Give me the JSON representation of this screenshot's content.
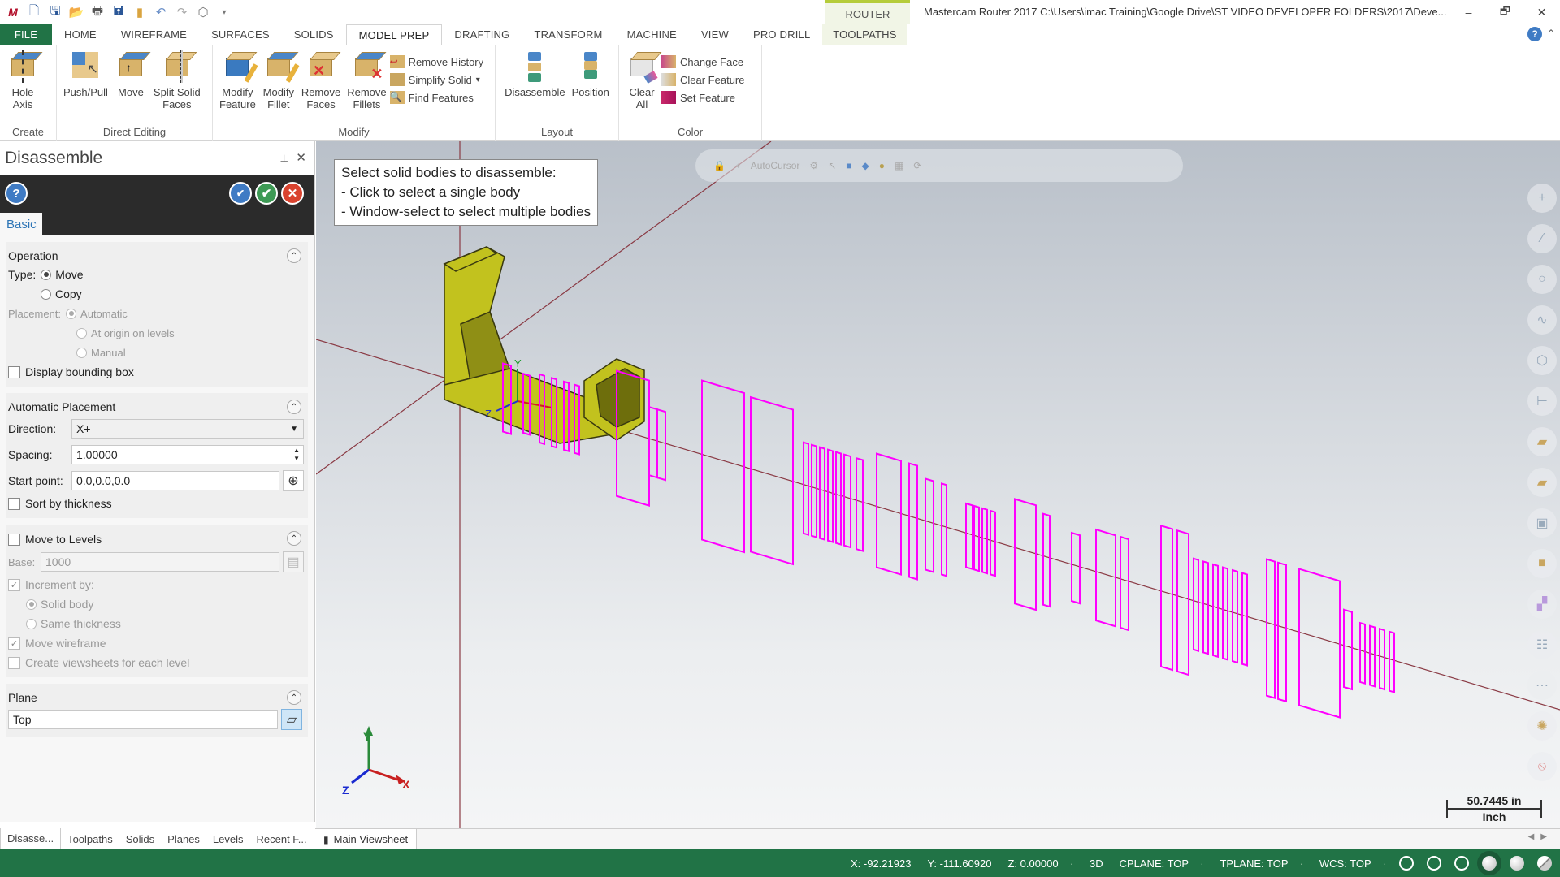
{
  "app": {
    "title": "Mastercam Router 2017  C:\\Users\\imac Training\\Google Drive\\ST VIDEO DEVELOPER FOLDERS\\2017\\Deve...",
    "context_tab": "ROUTER",
    "window_controls": {
      "minimize": "–",
      "restore": "🗗",
      "close": "✕"
    }
  },
  "quick_access": [
    "mastercam-logo",
    "new-icon",
    "save-icon",
    "open-icon",
    "print-icon",
    "save-as-icon",
    "folder-icon",
    "undo-icon",
    "redo-icon",
    "cube-icon",
    "customize-icon"
  ],
  "tabs": [
    {
      "label": "FILE",
      "kind": "file"
    },
    {
      "label": "HOME"
    },
    {
      "label": "WIREFRAME"
    },
    {
      "label": "SURFACES"
    },
    {
      "label": "SOLIDS"
    },
    {
      "label": "MODEL PREP",
      "active": true
    },
    {
      "label": "DRAFTING"
    },
    {
      "label": "TRANSFORM"
    },
    {
      "label": "MACHINE"
    },
    {
      "label": "VIEW"
    },
    {
      "label": "PRO DRILL"
    },
    {
      "label": "TOOLPATHS",
      "context": true
    }
  ],
  "ribbon": {
    "groups": [
      {
        "label": "Create",
        "buttons": [
          {
            "label1": "Hole",
            "label2": "Axis",
            "icon": "hole-axis-icon"
          }
        ]
      },
      {
        "label": "Direct Editing",
        "buttons": [
          {
            "label1": "Push/Pull",
            "label2": "",
            "icon": "push-pull-icon"
          },
          {
            "label1": "Move",
            "label2": "",
            "icon": "move-icon"
          },
          {
            "label1": "Split Solid",
            "label2": "Faces",
            "icon": "split-solid-faces-icon"
          }
        ]
      },
      {
        "label": "Modify",
        "buttons": [
          {
            "label1": "Modify",
            "label2": "Feature",
            "icon": "modify-feature-icon"
          },
          {
            "label1": "Modify",
            "label2": "Fillet",
            "icon": "modify-fillet-icon"
          },
          {
            "label1": "Remove",
            "label2": "Faces",
            "icon": "remove-faces-icon"
          },
          {
            "label1": "Remove",
            "label2": "Fillets",
            "icon": "remove-fillets-icon"
          }
        ],
        "small": [
          {
            "label": "Remove History",
            "icon": "remove-history-icon"
          },
          {
            "label": "Simplify Solid",
            "icon": "simplify-solid-icon",
            "dropdown": "▾"
          },
          {
            "label": "Find Features",
            "icon": "find-features-icon"
          }
        ]
      },
      {
        "label": "Layout",
        "buttons": [
          {
            "label1": "Disassemble",
            "label2": "",
            "icon": "disassemble-icon"
          },
          {
            "label1": "Position",
            "label2": "",
            "icon": "position-icon"
          }
        ]
      },
      {
        "label": "Color",
        "buttons": [
          {
            "label1": "Clear",
            "label2": "All",
            "icon": "clear-all-icon"
          }
        ],
        "small": [
          {
            "label": "Change Face",
            "icon": "change-face-icon"
          },
          {
            "label": "Clear Feature",
            "icon": "clear-feature-icon"
          },
          {
            "label": "Set Feature",
            "icon": "set-feature-icon"
          }
        ]
      }
    ]
  },
  "panel": {
    "title": "Disassemble",
    "pin": "📌",
    "close": "✕",
    "help": "?",
    "tab": "Basic",
    "operation": {
      "heading": "Operation",
      "type_label": "Type:",
      "type_options": [
        {
          "label": "Move",
          "selected": true
        },
        {
          "label": "Copy",
          "selected": false
        }
      ],
      "placement_label": "Placement:",
      "placement_options": [
        {
          "label": "Automatic",
          "selected": true
        },
        {
          "label": "At origin on levels",
          "selected": false
        },
        {
          "label": "Manual",
          "selected": false
        }
      ],
      "display_bbox": {
        "label": "Display bounding box",
        "checked": false
      }
    },
    "auto_placement": {
      "heading": "Automatic Placement",
      "direction_label": "Direction:",
      "direction_value": "X+",
      "spacing_label": "Spacing:",
      "spacing_value": "1.00000",
      "start_label": "Start point:",
      "start_value": "0.0,0.0,0.0",
      "sort": {
        "label": "Sort by thickness",
        "checked": false
      }
    },
    "levels": {
      "heading": "Move to Levels",
      "checked": false,
      "base_label": "Base:",
      "base_value": "1000",
      "increment": {
        "label": "Increment by:",
        "checked": true
      },
      "increment_options": [
        {
          "label": "Solid body",
          "selected": true
        },
        {
          "label": "Same thickness",
          "selected": false
        }
      ],
      "move_wireframe": {
        "label": "Move wireframe",
        "checked": true
      },
      "create_viewsheets": {
        "label": "Create viewsheets for each level",
        "checked": false
      }
    },
    "plane": {
      "heading": "Plane",
      "value": "Top"
    }
  },
  "bottom_tabs": [
    {
      "label": "Disasse...",
      "active": true
    },
    {
      "label": "Toolpaths"
    },
    {
      "label": "Solids"
    },
    {
      "label": "Planes"
    },
    {
      "label": "Levels"
    },
    {
      "label": "Recent F..."
    }
  ],
  "viewsheet": {
    "label": "Main Viewsheet"
  },
  "viewport": {
    "prompt": [
      "Select solid bodies to disassemble:",
      " - Click to select a single body",
      " - Window-select to select multiple bodies"
    ],
    "toolbar_label": "AutoCursor",
    "scale": {
      "value": "50.7445 in",
      "unit": "Inch"
    },
    "gnomon": {
      "x": "X",
      "y": "Y",
      "z": "Z"
    },
    "right_tools": [
      "add-point-icon",
      "line-icon",
      "circle-icon",
      "spline-icon",
      "view-cube-icon",
      "dimension-icon",
      "plane-icon",
      "plane-alt-icon",
      "solid-view-icon",
      "box-icon",
      "color-icon",
      "levels-icon",
      "attributes-icon",
      "settings-icon",
      "clear-icon"
    ]
  },
  "status": {
    "x": "X:  -92.21923",
    "y": "Y:  -111.60920",
    "z": "Z:  0.00000",
    "mode": "3D",
    "cplane": "CPLANE: TOP",
    "tplane": "TPLANE: TOP",
    "wcs": "WCS: TOP"
  },
  "colors": {
    "accent_green": "#217346",
    "wireframe": "#ff00ff",
    "solid": "#c8c81e",
    "axis": "#8a3a44"
  }
}
